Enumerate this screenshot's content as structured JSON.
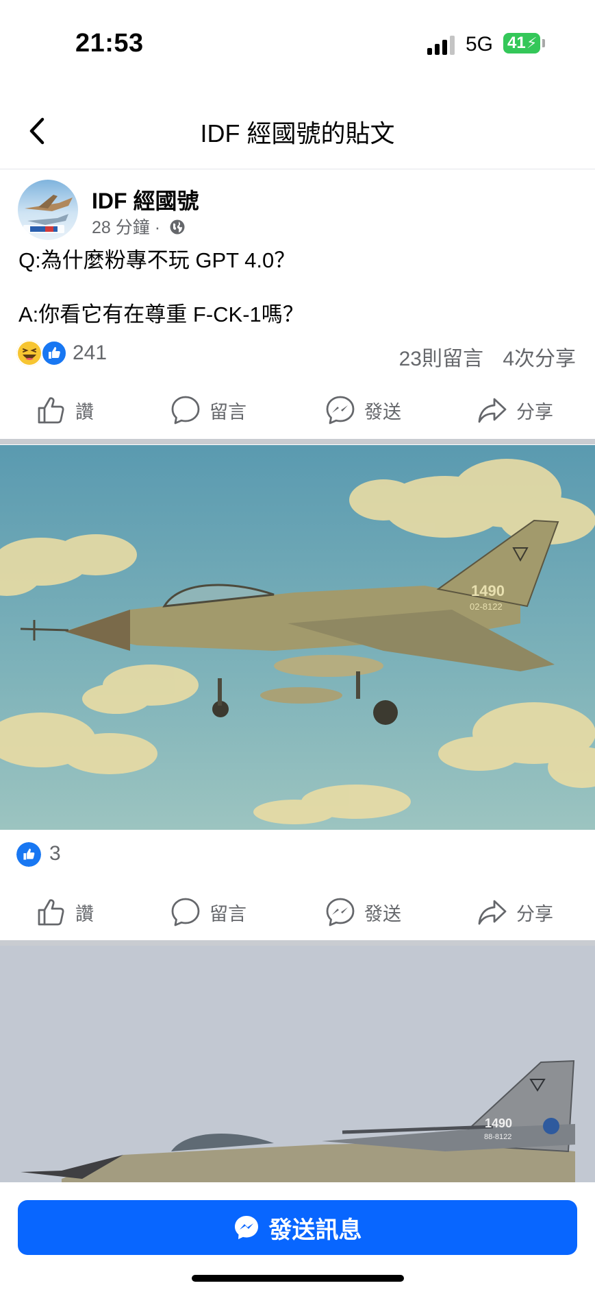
{
  "status_bar": {
    "time": "21:53",
    "network": "5G",
    "battery": "41"
  },
  "nav": {
    "title": "IDF 經國號的貼文"
  },
  "post": {
    "author": "IDF 經國號",
    "time_ago": "28 分鐘",
    "separator": "·",
    "text_q": "Q:為什麼粉專不玩 GPT 4.0？",
    "text_a": "A:你看它有在尊重 F-CK-1嗎？",
    "reactions_count": "241",
    "comments": "23則留言",
    "shares": "4次分享"
  },
  "actions": {
    "like": "讚",
    "comment": "留言",
    "send": "發送",
    "share": "分享"
  },
  "photo1": {
    "likes": "3",
    "tail_number": "1490",
    "serial": "02-8122"
  },
  "photo2": {
    "tail_number": "1490",
    "serial": "88-8122"
  },
  "bottom": {
    "send_message": "發送訊息"
  },
  "colors": {
    "brand_blue": "#0866ff",
    "like_blue": "#1877f2",
    "battery_green": "#34c759",
    "secondary_text": "#65676b"
  }
}
